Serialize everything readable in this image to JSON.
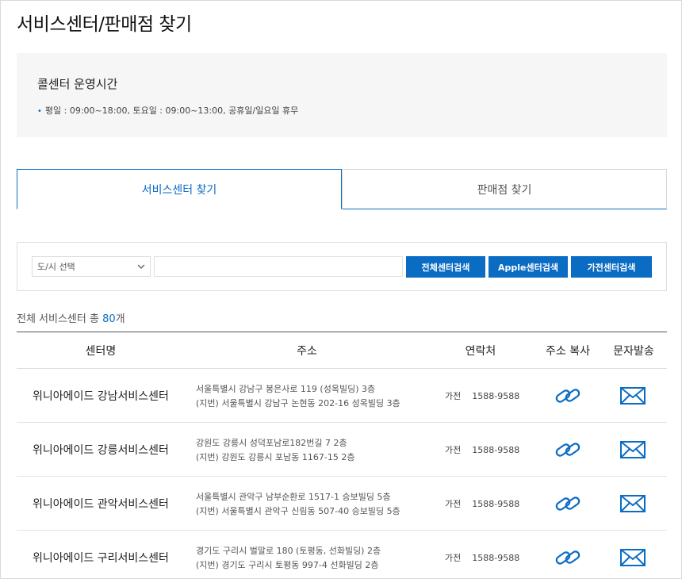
{
  "page": {
    "title": "서비스센터/판매점 찾기"
  },
  "notice": {
    "title": "콜센터 운영시간",
    "bullet": "•",
    "line": "평일 : 09:00~18:00, 토요일 : 09:00~13:00, 공휴일/일요일 휴무"
  },
  "tabs": [
    {
      "label": "서비스센터 찾기",
      "active": true
    },
    {
      "label": "판매점 찾기",
      "active": false
    }
  ],
  "search": {
    "select_value": "도/시 선택",
    "input_value": "",
    "buttons": [
      "전체센터검색",
      "Apple센터검색",
      "가전센터검색"
    ]
  },
  "summary": {
    "prefix": "전체 서비스센터 총 ",
    "count": "80",
    "suffix": "개"
  },
  "table": {
    "headers": [
      "센터명",
      "주소",
      "연락처",
      "주소 복사",
      "문자발송"
    ],
    "rows": [
      {
        "name": "위니아에이드 강남서비스센터",
        "addr1": "서울특별시 강남구 봉은사로 119 (성옥빌딩) 3층",
        "addr2": "(지번) 서울특별시 강남구 논현동 202-16 성옥빌딩 3층",
        "contact_label": "가전",
        "phone": "1588-9588"
      },
      {
        "name": "위니아에이드 강릉서비스센터",
        "addr1": "강원도 강릉시 성덕포남로182번길 7 2층",
        "addr2": "(지번) 강원도 강릉시 포남동 1167-15 2층",
        "contact_label": "가전",
        "phone": "1588-9588"
      },
      {
        "name": "위니아에이드 관악서비스센터",
        "addr1": "서울특별시 관악구 남부순환로 1517-1 승보빌딩 5층",
        "addr2": "(지번) 서울특별시 관악구 신림동 507-40 승보빌딩 5층",
        "contact_label": "가전",
        "phone": "1588-9588"
      },
      {
        "name": "위니아에이드 구리서비스센터",
        "addr1": "경기도 구리시 벌말로 180 (토평동, 선화빌딩) 2층",
        "addr2": "(지번) 경기도 구리시 토평동 997-4 선화빌딩 2층",
        "contact_label": "가전",
        "phone": "1588-9588"
      }
    ]
  },
  "icons": {
    "copy": "link-chain-icon",
    "sms": "envelope-icon",
    "select": "chevron-down-icon"
  },
  "colors": {
    "accent": "#0b6cc4"
  }
}
